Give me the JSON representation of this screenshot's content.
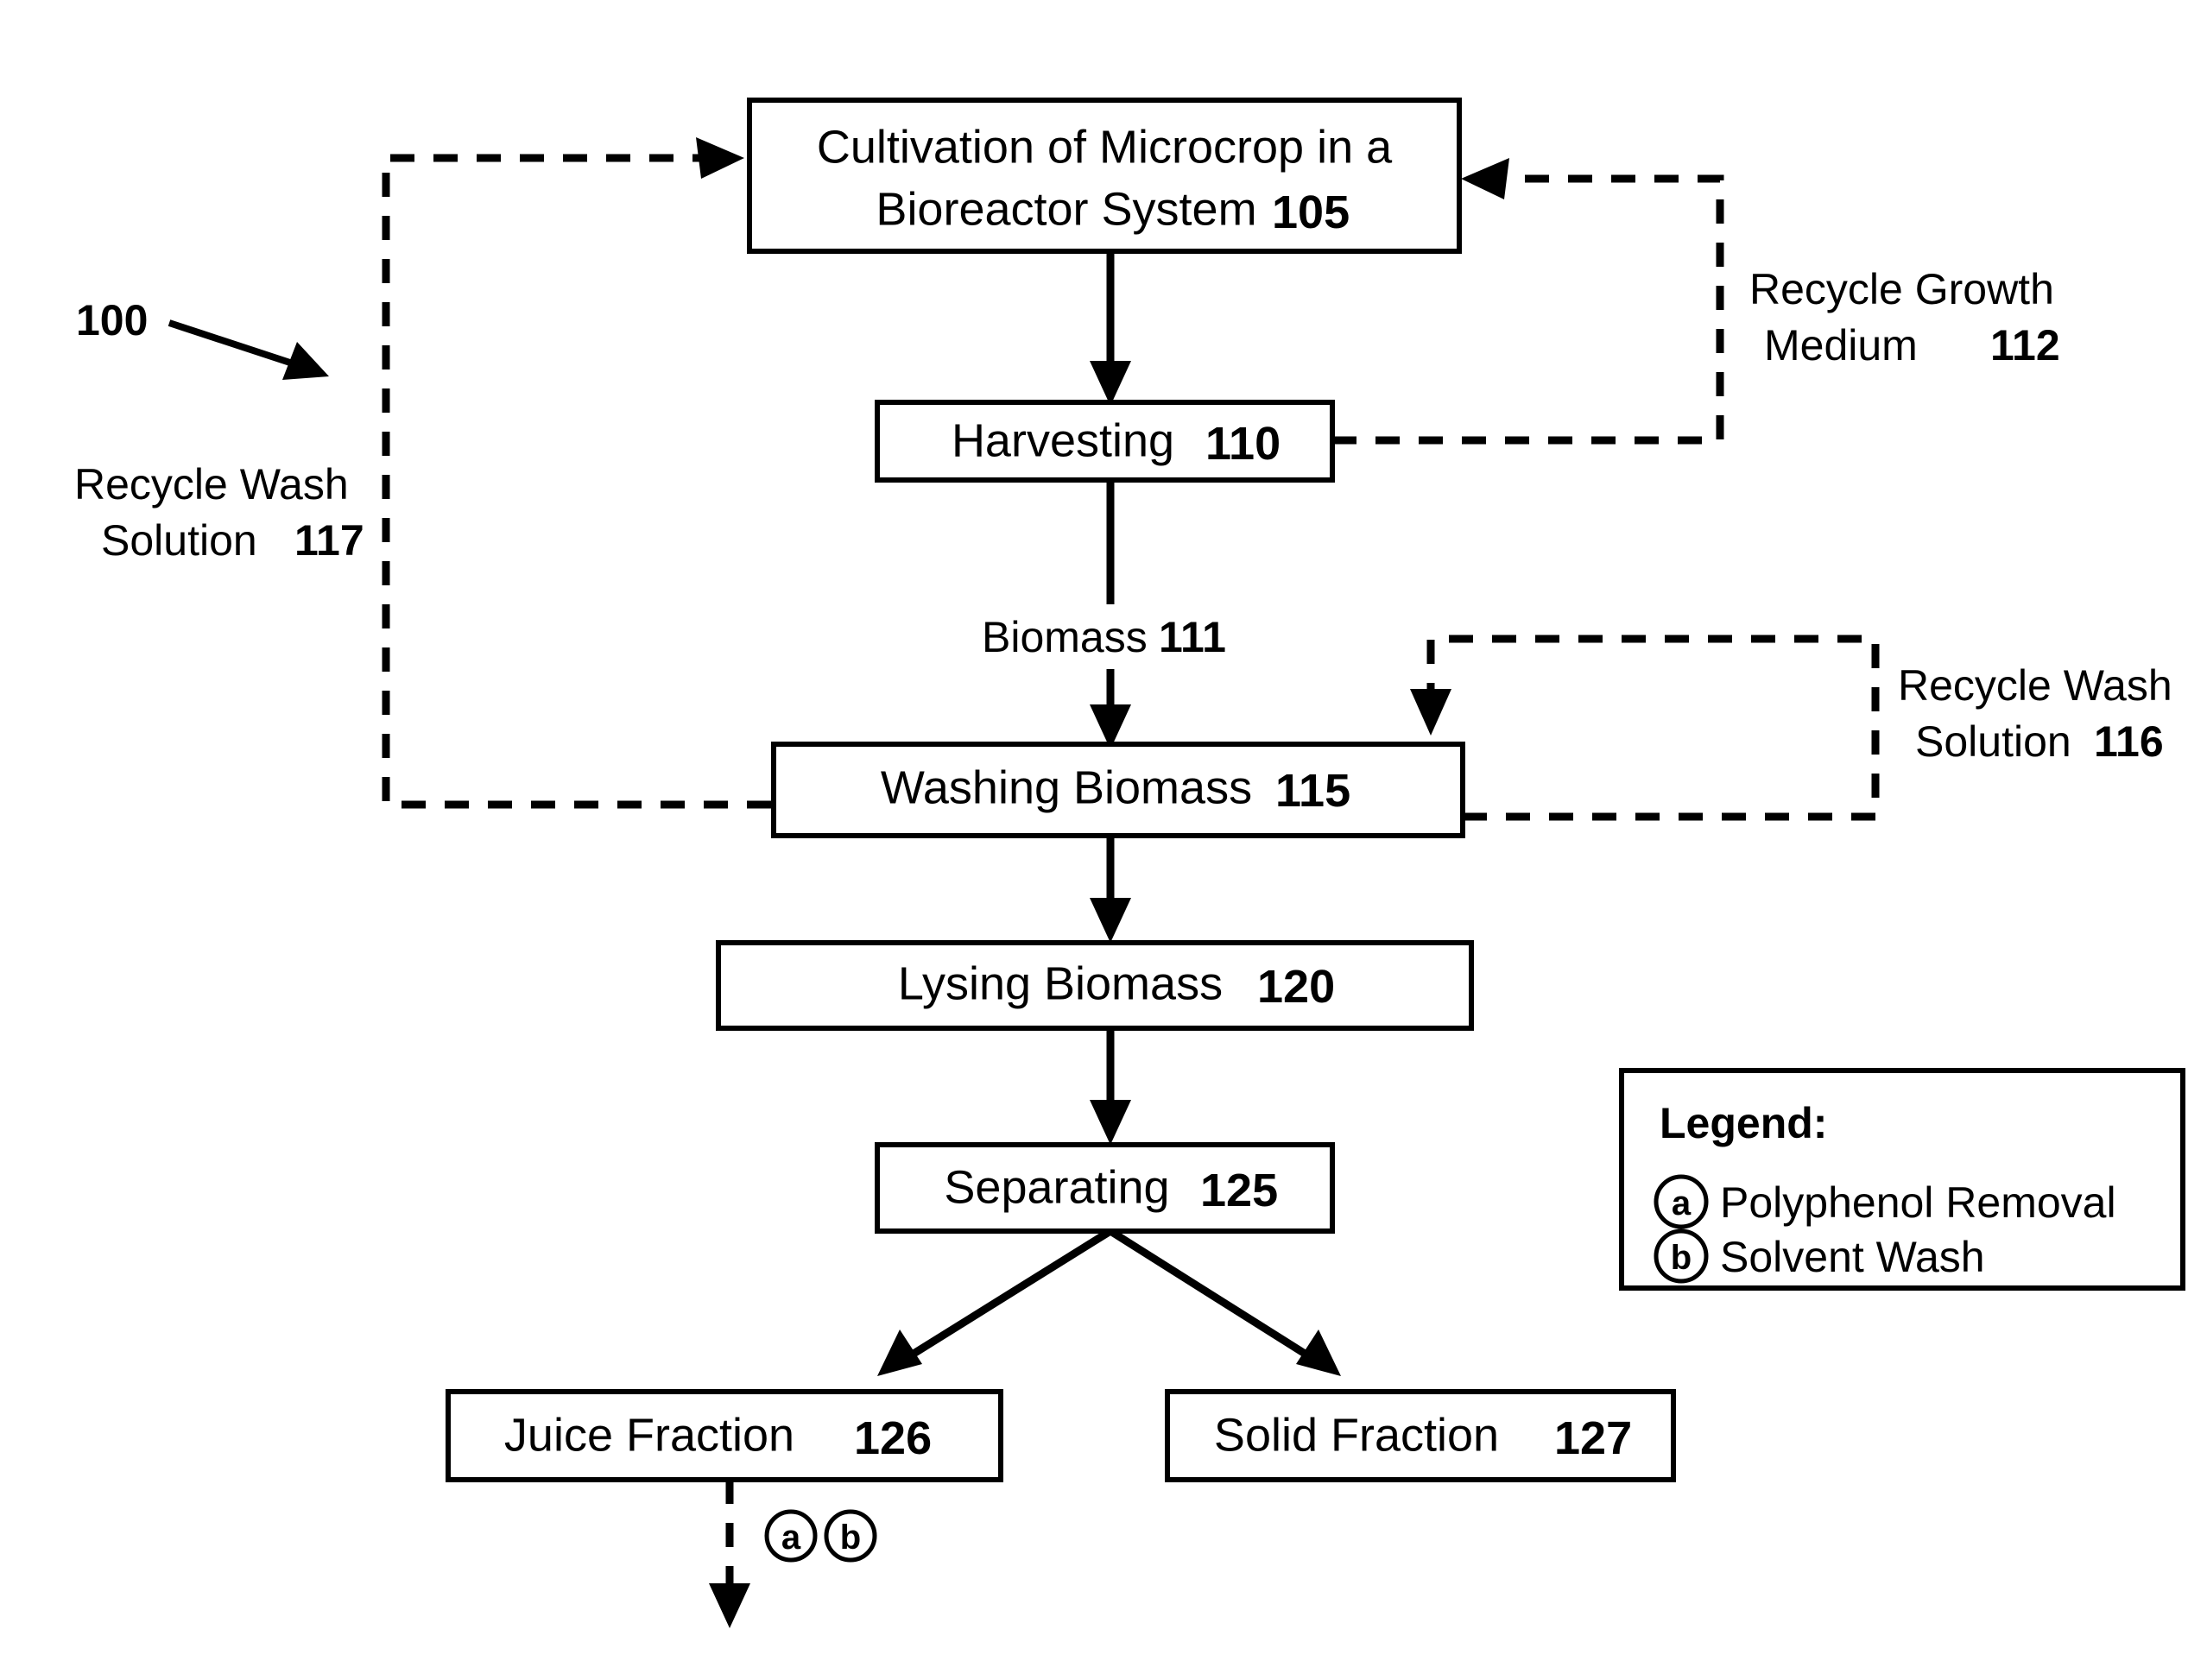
{
  "figure": {
    "reference_numeral": "100"
  },
  "boxes": {
    "cultivation": {
      "line1": "Cultivation of Microcrop in a",
      "line2": "Bioreactor System",
      "number": "105"
    },
    "harvesting": {
      "label": "Harvesting",
      "number": "110"
    },
    "washing": {
      "label": "Washing Biomass",
      "number": "115"
    },
    "lysing": {
      "label": "Lysing Biomass",
      "number": "120"
    },
    "separating": {
      "label": "Separating",
      "number": "125"
    },
    "juice_fraction": {
      "label": "Juice Fraction",
      "number": "126"
    },
    "solid_fraction": {
      "label": "Solid Fraction",
      "number": "127"
    }
  },
  "flow_labels": {
    "biomass": {
      "text": "Biomass",
      "number": "111"
    },
    "recycle_wash_solution_117": {
      "line1": "Recycle Wash",
      "line2": "Solution",
      "number": "117"
    },
    "recycle_growth_medium_112": {
      "line1": "Recycle Growth",
      "line2": "Medium",
      "number": "112"
    },
    "recycle_wash_solution_116": {
      "line1": "Recycle Wash",
      "line2": "Solution",
      "number": "116"
    }
  },
  "markers": {
    "a": "a",
    "b": "b"
  },
  "legend": {
    "title": "Legend:",
    "items": [
      {
        "symbol": "a",
        "text": "Polyphenol Removal"
      },
      {
        "symbol": "b",
        "text": "Solvent Wash"
      }
    ]
  },
  "colors": {
    "ink": "#000000",
    "paper": "#ffffff"
  }
}
